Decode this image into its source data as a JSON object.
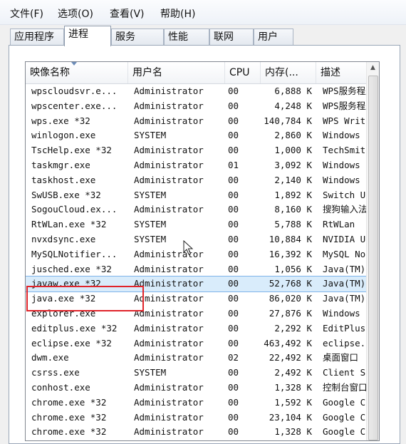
{
  "menu": [
    "文件(F)",
    "选项(O)",
    "查看(V)",
    "帮助(H)"
  ],
  "tabs": [
    "应用程序",
    "进程",
    "服务",
    "性能",
    "联网",
    "用户"
  ],
  "active_tab": 1,
  "columns": [
    "映像名称",
    "用户名",
    "CPU",
    "内存(...",
    "描述"
  ],
  "selected_row": 13,
  "rows": [
    {
      "name": "wpscloudsvr.e...",
      "user": "Administrator",
      "cpu": "00",
      "mem": "6,888 K",
      "desc": "WPS服务程序"
    },
    {
      "name": "wpscenter.exe...",
      "user": "Administrator",
      "cpu": "00",
      "mem": "4,248 K",
      "desc": "WPS服务程序"
    },
    {
      "name": "wps.exe *32",
      "user": "Administrator",
      "cpu": "00",
      "mem": "140,784 K",
      "desc": "WPS Writer"
    },
    {
      "name": "winlogon.exe",
      "user": "SYSTEM",
      "cpu": "00",
      "mem": "2,860 K",
      "desc": "Windows"
    },
    {
      "name": "TscHelp.exe *32",
      "user": "Administrator",
      "cpu": "00",
      "mem": "1,000 K",
      "desc": "TechSmith"
    },
    {
      "name": "taskmgr.exe",
      "user": "Administrator",
      "cpu": "01",
      "mem": "3,092 K",
      "desc": "Windows"
    },
    {
      "name": "taskhost.exe",
      "user": "Administrator",
      "cpu": "00",
      "mem": "2,140 K",
      "desc": "Windows"
    },
    {
      "name": "SwUSB.exe *32",
      "user": "SYSTEM",
      "cpu": "00",
      "mem": "1,892 K",
      "desc": "Switch USB"
    },
    {
      "name": "SogouCloud.ex...",
      "user": "Administrator",
      "cpu": "00",
      "mem": "8,160 K",
      "desc": "搜狗输入法"
    },
    {
      "name": "RtWLan.exe *32",
      "user": "SYSTEM",
      "cpu": "00",
      "mem": "5,788 K",
      "desc": "RtWLan"
    },
    {
      "name": "nvxdsync.exe",
      "user": "SYSTEM",
      "cpu": "00",
      "mem": "10,884 K",
      "desc": "NVIDIA User"
    },
    {
      "name": "MySQLNotifier...",
      "user": "Administrator",
      "cpu": "00",
      "mem": "16,392 K",
      "desc": "MySQL Notifier"
    },
    {
      "name": "jusched.exe *32",
      "user": "Administrator",
      "cpu": "00",
      "mem": "1,056 K",
      "desc": "Java(TM)"
    },
    {
      "name": "javaw.exe *32",
      "user": "Administrator",
      "cpu": "00",
      "mem": "52,768 K",
      "desc": "Java(TM)"
    },
    {
      "name": "java.exe *32",
      "user": "Administrator",
      "cpu": "00",
      "mem": "86,020 K",
      "desc": "Java(TM)"
    },
    {
      "name": "explorer.exe",
      "user": "Administrator",
      "cpu": "00",
      "mem": "27,876 K",
      "desc": "Windows"
    },
    {
      "name": "editplus.exe *32",
      "user": "Administrator",
      "cpu": "00",
      "mem": "2,292 K",
      "desc": "EditPlus"
    },
    {
      "name": "eclipse.exe *32",
      "user": "Administrator",
      "cpu": "00",
      "mem": "463,492 K",
      "desc": "eclipse.exe"
    },
    {
      "name": "dwm.exe",
      "user": "Administrator",
      "cpu": "02",
      "mem": "22,492 K",
      "desc": "桌面窗口"
    },
    {
      "name": "csrss.exe",
      "user": "SYSTEM",
      "cpu": "00",
      "mem": "2,492 K",
      "desc": "Client Server"
    },
    {
      "name": "conhost.exe",
      "user": "Administrator",
      "cpu": "00",
      "mem": "1,328 K",
      "desc": "控制台窗口"
    },
    {
      "name": "chrome.exe *32",
      "user": "Administrator",
      "cpu": "00",
      "mem": "1,592 K",
      "desc": "Google Chrome"
    },
    {
      "name": "chrome.exe *32",
      "user": "Administrator",
      "cpu": "00",
      "mem": "23,104 K",
      "desc": "Google Chrome"
    },
    {
      "name": "chrome.exe *32",
      "user": "Administrator",
      "cpu": "00",
      "mem": "1,328 K",
      "desc": "Google Chrome"
    }
  ],
  "colors": {
    "selection": "#d9ecfb",
    "annotation_box": "#e0242a"
  }
}
